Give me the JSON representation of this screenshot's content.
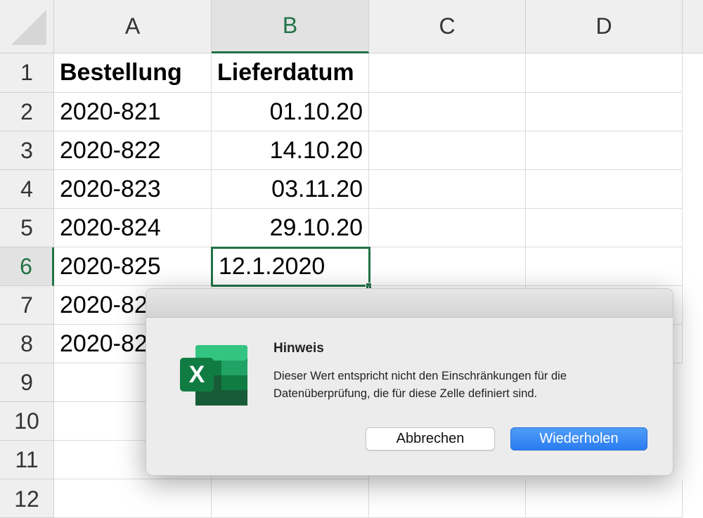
{
  "sheet": {
    "columns": [
      "A",
      "B",
      "C",
      "D"
    ],
    "selected_column": "B",
    "rows": [
      "1",
      "2",
      "3",
      "4",
      "5",
      "6",
      "7",
      "8",
      "9",
      "10",
      "11",
      "12"
    ],
    "selected_row": "6",
    "cells": [
      {
        "a": "Bestellung",
        "b": "Lieferdatum"
      },
      {
        "a": "2020-821",
        "b": "01.10.20"
      },
      {
        "a": "2020-822",
        "b": "14.10.20"
      },
      {
        "a": "2020-823",
        "b": "03.11.20"
      },
      {
        "a": "2020-824",
        "b": "29.10.20"
      },
      {
        "a": "2020-825",
        "b": "12.1.2020"
      },
      {
        "a": "2020-826",
        "b": ""
      },
      {
        "a": "2020-827",
        "b": ""
      }
    ],
    "active_cell": "B6"
  },
  "dialog": {
    "title": "Hinweis",
    "message": "Dieser Wert entspricht nicht den Einschränkungen für die Datenüberprüfung, die für diese Zelle definiert sind.",
    "cancel_label": "Abbrechen",
    "retry_label": "Wiederholen",
    "icon": "excel-app-icon",
    "icon_letter": "X",
    "accent": "#217346",
    "button_color": "#2a7cf0"
  }
}
